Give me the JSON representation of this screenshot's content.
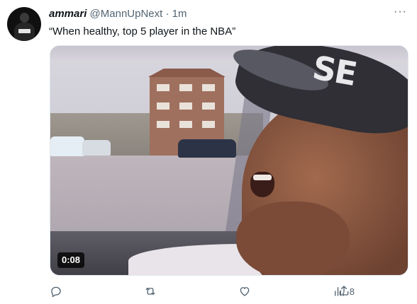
{
  "author": {
    "display_name": "ammari",
    "handle": "@MannUpNext",
    "separator": "·",
    "timestamp": "1m",
    "avatar_icon": "avatar-image"
  },
  "more_menu": {
    "icon": "more-horizontal-icon",
    "label": "···"
  },
  "tweet_text": "“When healthy, top 5 player in the NBA”",
  "media": {
    "type": "video",
    "duration": "0:08",
    "cap_text": "SE"
  },
  "actions": {
    "reply": {
      "icon": "reply-icon",
      "count": ""
    },
    "retweet": {
      "icon": "retweet-icon",
      "count": ""
    },
    "like": {
      "icon": "like-icon",
      "count": ""
    },
    "views": {
      "icon": "views-icon",
      "count": "8"
    },
    "share": {
      "icon": "share-icon"
    }
  },
  "colors": {
    "text": "#0f1419",
    "secondary": "#536471",
    "background": "#ffffff"
  }
}
